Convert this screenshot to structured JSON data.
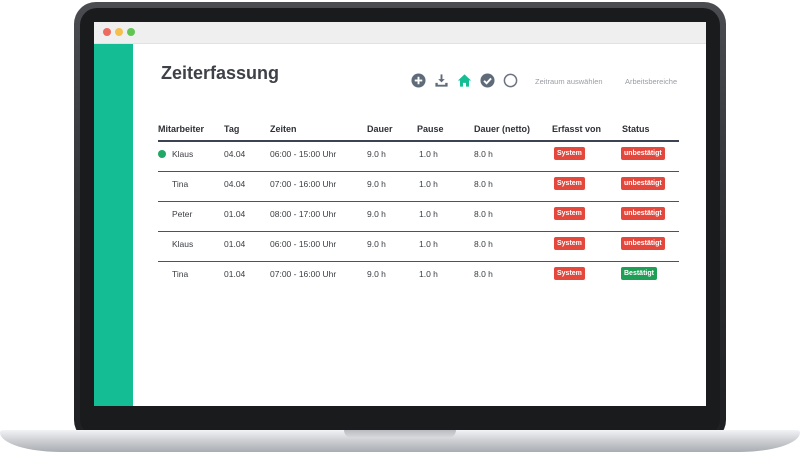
{
  "app": {
    "title": "Zeiterfassung"
  },
  "toolbar": {
    "icons": [
      "add-icon",
      "download-icon",
      "home-icon",
      "check-circle-icon",
      "circle-icon"
    ],
    "period_label": "Zeitraum auswählen",
    "areas_label": "Arbeitsbereiche"
  },
  "colors": {
    "accent": "#15bd94",
    "online": "#21a865",
    "badge_red": "#e4473c",
    "badge_green": "#1f9e56"
  },
  "table": {
    "headers": [
      "Mitarbeiter",
      "Tag",
      "Zeiten",
      "Dauer",
      "Pause",
      "Dauer (netto)",
      "Erfasst von",
      "Status"
    ],
    "rows": [
      {
        "name": "Klaus",
        "day": "04.04",
        "times": "06:00 - 15:00 Uhr",
        "duration": "9.0 h",
        "pause": "1.0  h",
        "net": "8.0  h",
        "source": "System",
        "status": "unbestätigt",
        "confirmed": false,
        "online": true
      },
      {
        "name": "Tina",
        "day": "04.04",
        "times": "07:00 - 16:00 Uhr",
        "duration": "9.0 h",
        "pause": "1.0  h",
        "net": "8.0  h",
        "source": "System",
        "status": "unbestätigt",
        "confirmed": false,
        "online": false
      },
      {
        "name": "Peter",
        "day": "01.04",
        "times": "08:00 - 17:00 Uhr",
        "duration": "9.0 h",
        "pause": "1.0  h",
        "net": "8.0  h",
        "source": "System",
        "status": "unbestätigt",
        "confirmed": false,
        "online": false
      },
      {
        "name": "Klaus",
        "day": "01.04",
        "times": "06:00 - 15:00 Uhr",
        "duration": "9.0 h",
        "pause": "1.0  h",
        "net": "8.0  h",
        "source": "System",
        "status": "unbestätigt",
        "confirmed": false,
        "online": false
      },
      {
        "name": "Tina",
        "day": "01.04",
        "times": "07:00 - 16:00 Uhr",
        "duration": "9.0 h",
        "pause": "1.0  h",
        "net": "8.0  h",
        "source": "System",
        "status": "Bestätigt",
        "confirmed": true,
        "online": false
      }
    ]
  }
}
